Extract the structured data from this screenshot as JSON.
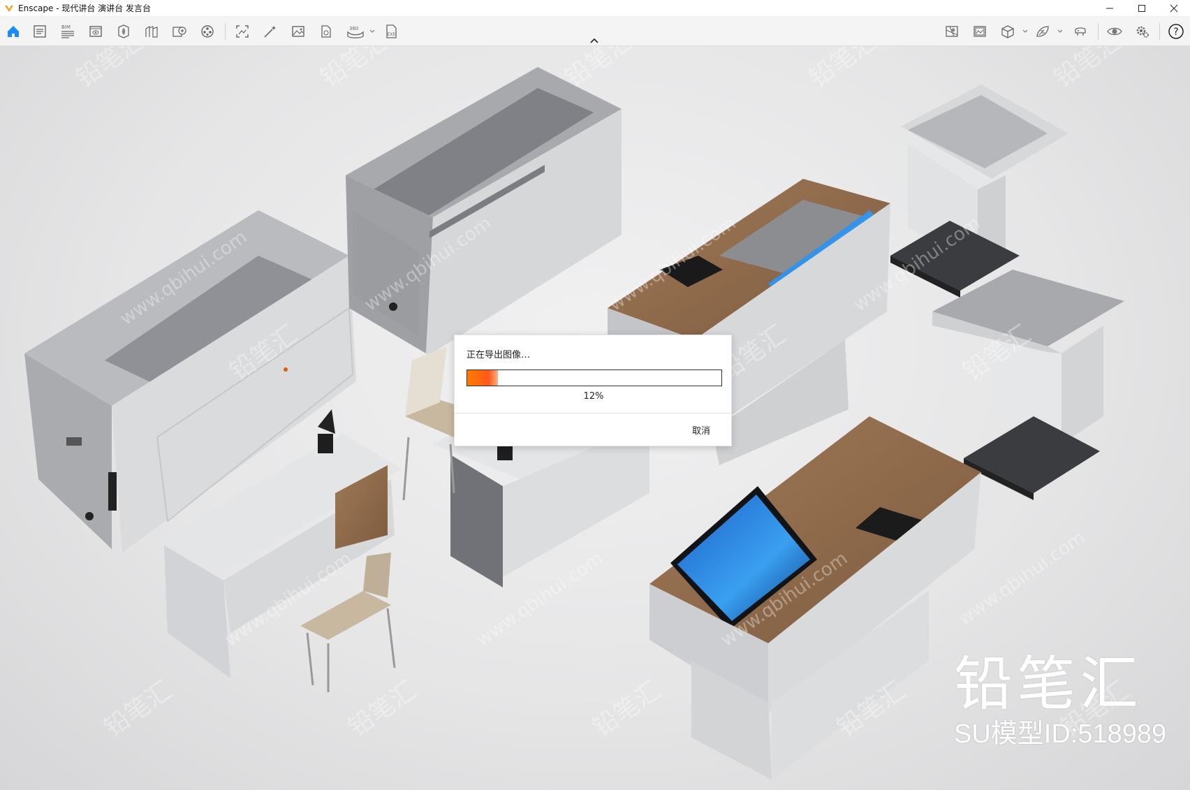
{
  "window": {
    "title": "Enscape - 现代讲台 演讲台 发言台",
    "controls": [
      "minimize-icon",
      "maximize-icon",
      "close-icon"
    ]
  },
  "toolbar": {
    "left_icons": [
      "home-icon",
      "document-icon",
      "bim-panel-icon",
      "visual-settings-icon",
      "asset-library-icon",
      "materials-icon",
      "book-add-icon",
      "video-editor-icon",
      "screenshot-icon",
      "magic-wand-icon",
      "render-image-icon",
      "render-file-icon",
      "panorama-360-icon",
      "export-exe-icon"
    ],
    "bim_badge": "BIM",
    "pano_badge": "360",
    "exe_badge": "EXE",
    "right_icons": [
      "map-icon",
      "image-gallery-icon",
      "cube-view-icon",
      "feedback-icon",
      "vr-headset-icon",
      "eye-icon",
      "settings-icon",
      "help-icon"
    ],
    "help_glyph": "?"
  },
  "dialog": {
    "message": "正在导出图像…",
    "progress": 0.12,
    "percent_label": "12%",
    "cancel_label": "取消",
    "accent_color": "#ff6a00"
  },
  "watermark": {
    "brand": "铅笔汇",
    "site": "www.qbihui.com"
  },
  "brand_overlay": {
    "title": "铅笔汇",
    "model_id": "SU模型ID:518989"
  }
}
